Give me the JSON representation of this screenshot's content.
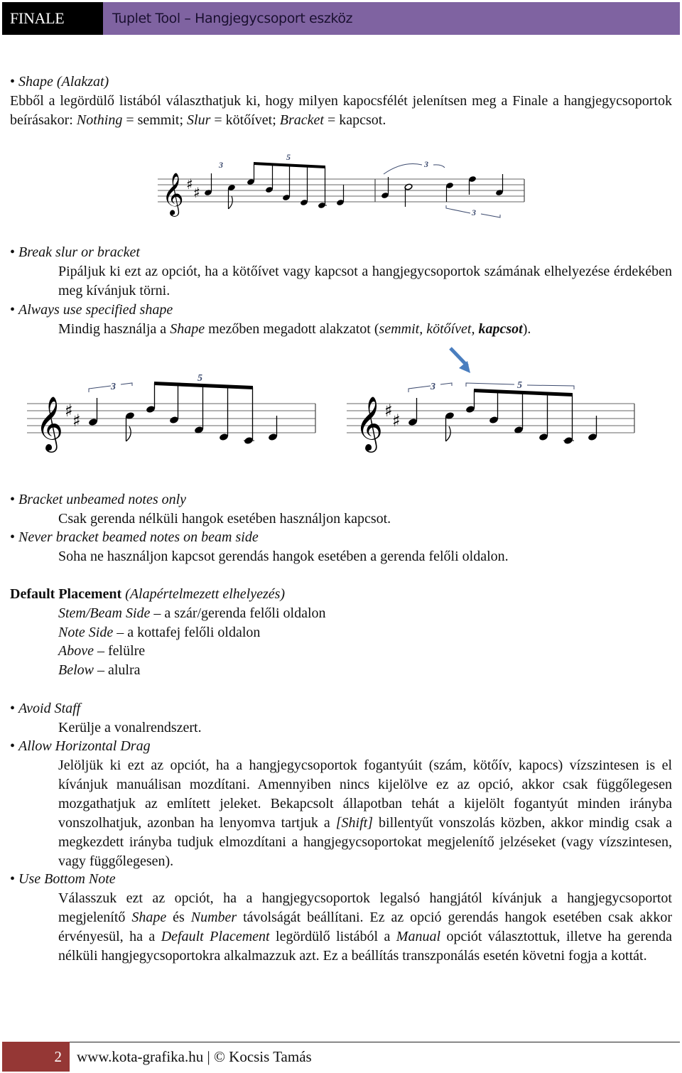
{
  "header": {
    "brand": "FINALE",
    "title": "Tuplet Tool – Hangjegycsoport eszköz"
  },
  "shape": {
    "bullet": "•",
    "heading": "Shape (Alakzat)",
    "text_parts": [
      "Ebből a legördülő listából választhatjuk ki, hogy milyen kapocsfélét jelenítsen meg a Finale a hangjegycsoportok beírásakor: ",
      "Nothing",
      " = semmit; ",
      "Slur",
      " = kötőívet; ",
      "Bracket",
      " = kapcsot."
    ]
  },
  "figure1": {
    "description": "Music example: tuplets with nothing, slur and bracket shapes",
    "tuplet_numbers": [
      "3",
      "5",
      "3",
      "3"
    ]
  },
  "options1": [
    {
      "bullet": "•",
      "label": "Break slur or bracket",
      "text": "Pipáljuk ki ezt az opciót, ha a kötőívet vagy kapcsot a hangjegycsoportok számának elhelyezése érdekében meg kívánjuk törni."
    },
    {
      "bullet": "•",
      "label": "Always use specified shape",
      "text_parts": [
        "Mindig használja a ",
        "Shape",
        " mezőben megadott alakzatot (",
        "semmit, kötőívet, ",
        "kapcsot",
        ")."
      ]
    }
  ],
  "figure2": {
    "description": "Two music examples comparing bracket placement; right one marked with blue arrow",
    "left_tuplets": [
      "3",
      "5"
    ],
    "right_tuplets": [
      "3",
      "5"
    ],
    "arrow_color": "#4a7ebf"
  },
  "options2": [
    {
      "bullet": "•",
      "label": "Bracket unbeamed notes only",
      "text": "Csak gerenda nélküli hangok esetében használjon kapcsot."
    },
    {
      "bullet": "•",
      "label": "Never bracket beamed notes on beam side",
      "text": "Soha ne használjon kapcsot gerendás hangok esetében a gerenda felőli oldalon."
    }
  ],
  "default_placement": {
    "title": "Default Placement",
    "subtitle": "(Alapértelmezett elhelyezés)",
    "items": [
      {
        "term": "Stem/Beam Side",
        "desc": " – a szár/gerenda felőli oldalon"
      },
      {
        "term": "Note Side",
        "desc": " – a kottafej felőli oldalon"
      },
      {
        "term": "Above",
        "desc": " – felülre"
      },
      {
        "term": "Below",
        "desc": " – alulra"
      }
    ]
  },
  "options3": [
    {
      "bullet": "•",
      "label": "Avoid Staff",
      "text": "Kerülje a vonalrendszert."
    },
    {
      "bullet": "•",
      "label": "Allow Horizontal Drag",
      "text_parts": [
        "Jelöljük ki ezt az opciót, ha a hangjegycsoportok fogantyúit (szám, kötőív, kapocs) vízszintesen is el kívánjuk manuálisan mozdítani. Amennyiben nincs kijelölve ez az opció, akkor csak függőlegesen mozgathatjuk az említett jeleket. Bekapcsolt állapotban tehát a kijelölt fogantyút minden irányba vonszolhatjuk, azonban ha lenyomva tartjuk a ",
        "[Shift]",
        " billentyűt vonszolás közben, akkor mindig csak a megkezdett irányba tudjuk elmozdítani a hangjegycsoportokat megjelenítő jelzéseket (vagy vízszintesen, vagy függőlegesen)."
      ]
    },
    {
      "bullet": "•",
      "label": "Use Bottom Note",
      "text_parts": [
        "Válasszuk ezt az opciót, ha a hangjegycsoportok legalsó hangjától kívánjuk a hangjegycsoportot megjelenítő ",
        "Shape",
        " és ",
        "Number",
        " távolságát beállítani. Ez az opció gerendás hangok esetében csak akkor érvényesül, ha a ",
        "Default Placement",
        " legördülő listából a ",
        "Manual",
        " opciót választottuk, illetve ha gerenda nélküli hangjegycsoportokra alkalmazzuk azt. Ez a beállítás transzponálás esetén követni fogja a kottát."
      ]
    }
  ],
  "footer": {
    "page_number": "2",
    "text": "www.kota-grafika.hu | © Kocsis Tamás"
  },
  "colors": {
    "header_brand_bg": "#000000",
    "header_title_bg": "#7f63a1",
    "footer_num_bg": "#953735",
    "tuplet_number": "#3c4a6e"
  }
}
